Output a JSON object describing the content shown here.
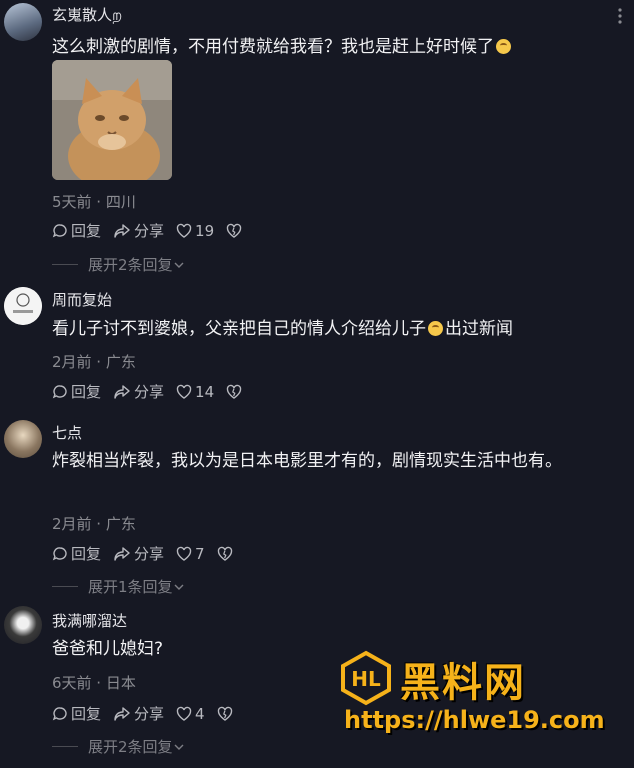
{
  "comments": [
    {
      "username": "玄嵬散人ற",
      "text": "这么刺激的剧情，不用付费就给我看？我也是赶上好时候了",
      "time_location": "5天前 · 四川",
      "reply_label": "回复",
      "share_label": "分享",
      "likes": "19",
      "expand_label": "展开2条回复"
    },
    {
      "username": "周而复始",
      "text_before_emoji": "看儿子讨不到婆娘，父亲把自己的情人介绍给儿子",
      "text_after_emoji": "出过新闻",
      "time_location": "2月前 · 广东",
      "reply_label": "回复",
      "share_label": "分享",
      "likes": "14"
    },
    {
      "username": "七点",
      "text": "炸裂相当炸裂，我以为是日本电影里才有的，剧情现实生活中也有。",
      "time_location": "2月前 · 广东",
      "reply_label": "回复",
      "share_label": "分享",
      "likes": "7",
      "expand_label": "展开1条回复"
    },
    {
      "username": "我满哪溜达",
      "text": "爸爸和儿媳妇?",
      "time_location": "6天前 · 日本",
      "reply_label": "回复",
      "share_label": "分享",
      "likes": "4",
      "expand_label": "展开2条回复"
    }
  ],
  "watermark": {
    "name": "黑料网",
    "url": "https://hlwe19.com"
  },
  "icons": {
    "reply": "comment-bubble-icon",
    "share": "share-arrow-icon",
    "like": "heart-icon",
    "dislike": "broken-heart-icon",
    "more": "more-dots-icon",
    "expand": "chevron-down-icon"
  },
  "colors": {
    "background": "#161823",
    "meta_text": "#8a8b91",
    "watermark": "#f6b21a"
  }
}
